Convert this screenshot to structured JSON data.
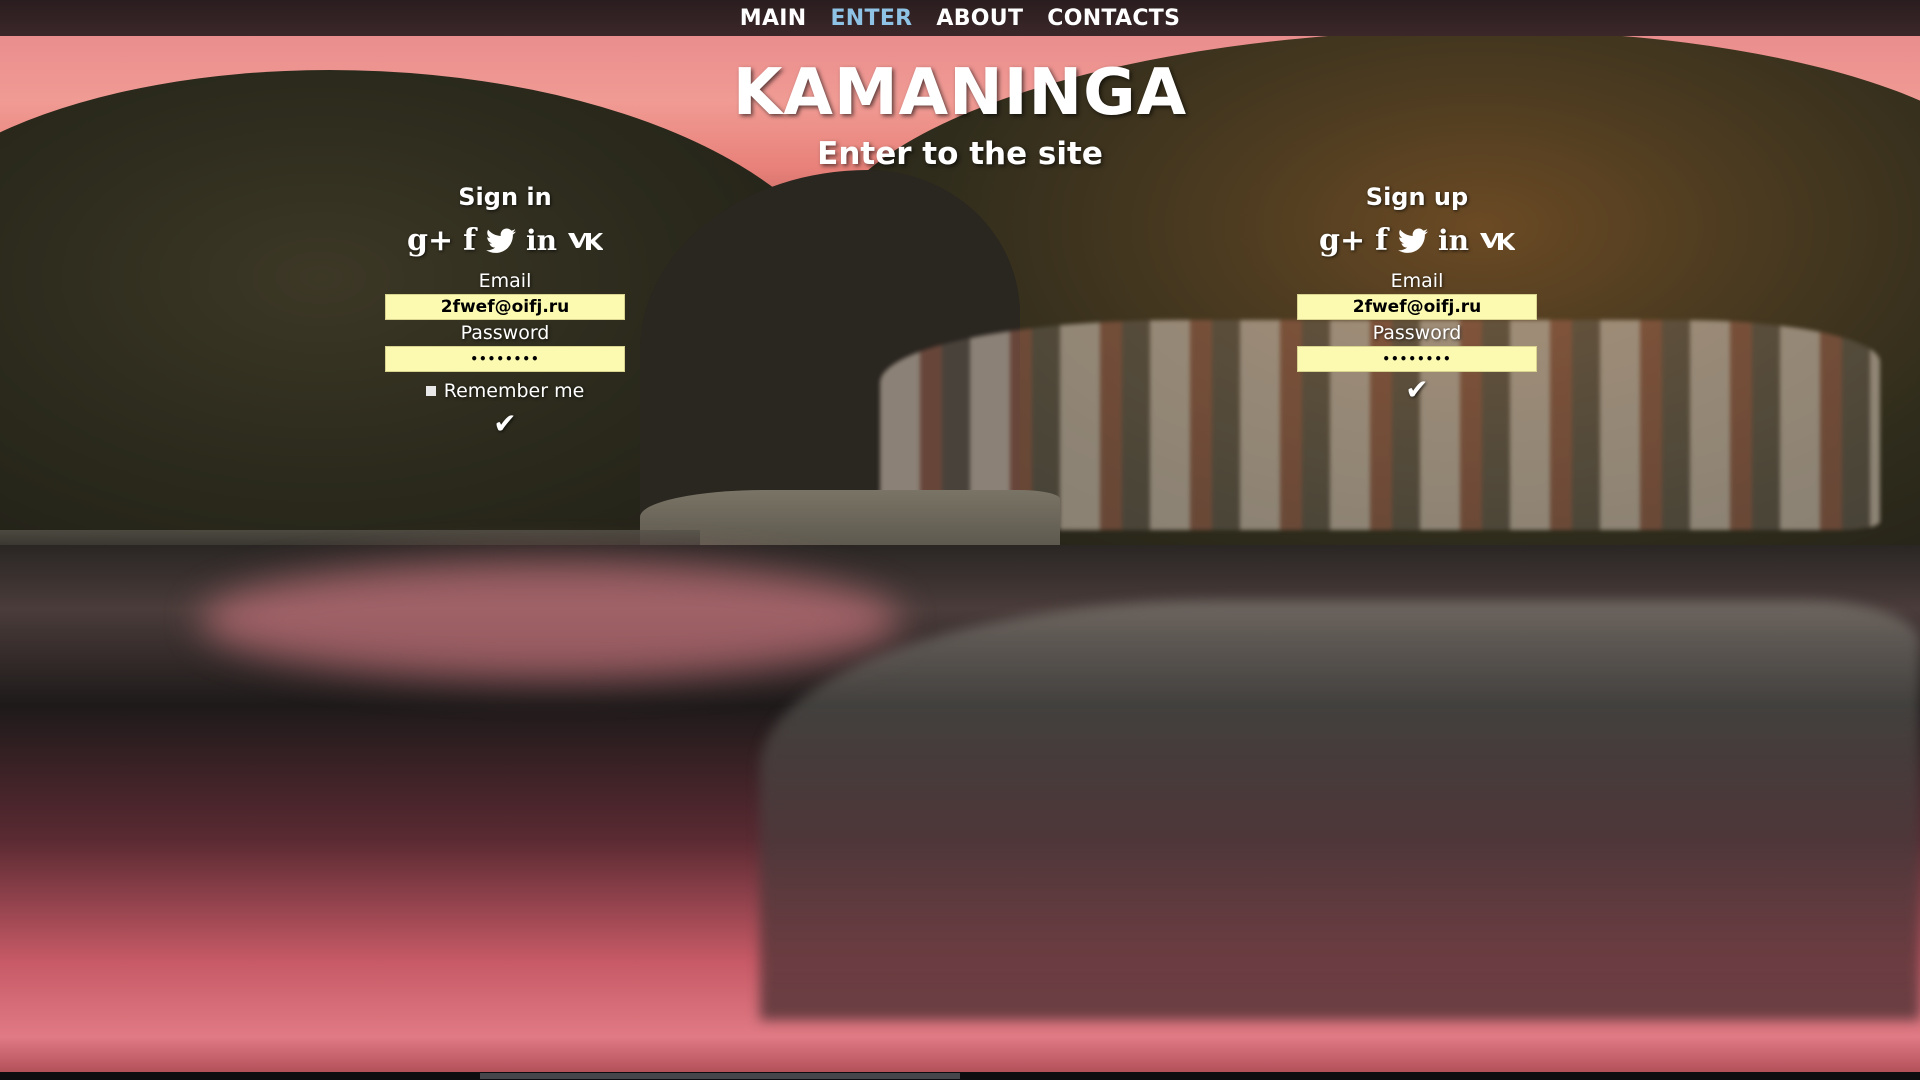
{
  "nav": {
    "items": [
      {
        "label": "MAIN",
        "active": false
      },
      {
        "label": "ENTER",
        "active": true
      },
      {
        "label": "ABOUT",
        "active": false
      },
      {
        "label": "CONTACTS",
        "active": false
      }
    ]
  },
  "header": {
    "title": "KAMANINGA",
    "subtitle": "Enter to the site"
  },
  "signin": {
    "heading": "Sign in",
    "social": [
      "google-plus-icon",
      "facebook-icon",
      "twitter-icon",
      "linkedin-icon",
      "vk-icon"
    ],
    "email_label": "Email",
    "email_value": "2fwef@oifj.ru",
    "password_label": "Password",
    "password_value": "••••••••",
    "remember_label": "Remember me",
    "submit_symbol": "✔"
  },
  "signup": {
    "heading": "Sign up",
    "social": [
      "google-plus-icon",
      "facebook-icon",
      "twitter-icon",
      "linkedin-icon",
      "vk-icon"
    ],
    "email_label": "Email",
    "email_value": "2fwef@oifj.ru",
    "password_label": "Password",
    "password_value": "••••••••",
    "submit_symbol": "✔"
  },
  "colors": {
    "nav_active": "#8fc3e6",
    "input_background": "#fbfab0"
  },
  "social_glyphs": {
    "google_plus": "g+",
    "facebook": "f",
    "linkedin": "in"
  }
}
